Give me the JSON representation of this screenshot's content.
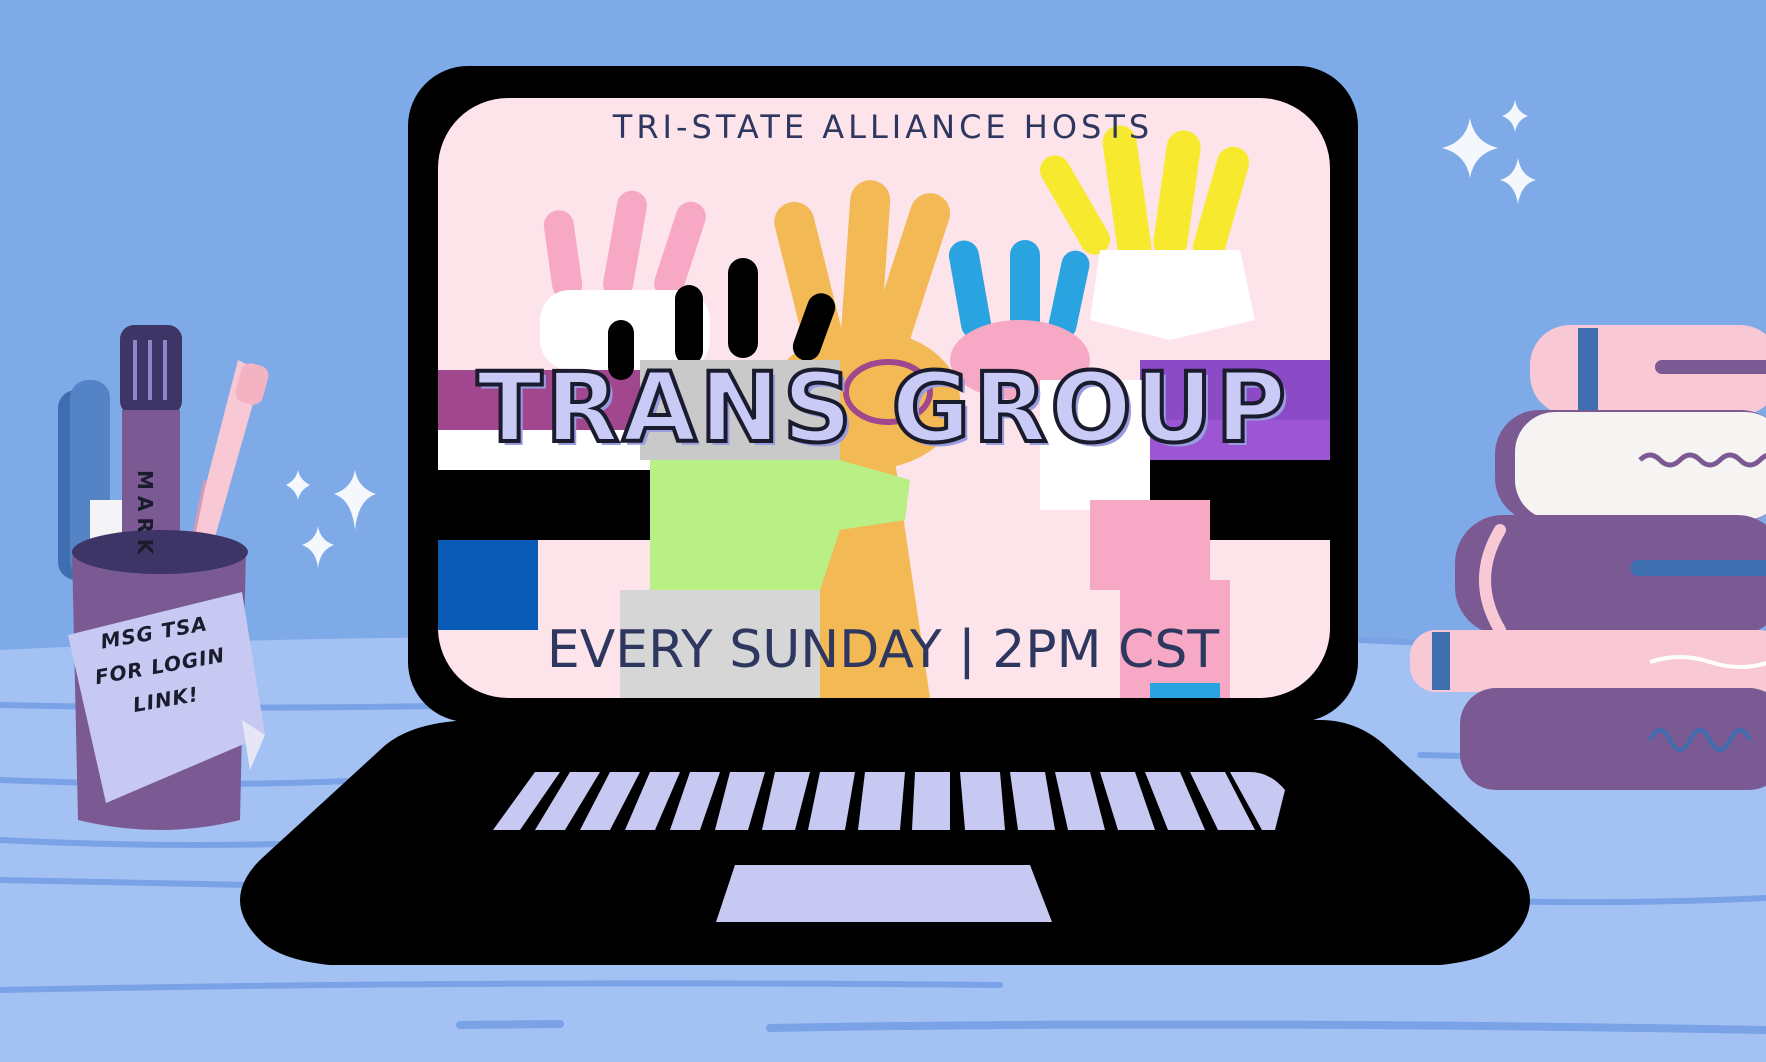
{
  "screen": {
    "headline": "TRI-STATE ALLIANCE HOSTS",
    "title": "TRANS GROUP",
    "schedule": "EVERY SUNDAY | 2PM CST"
  },
  "sticky_note": {
    "lines": [
      "MSG TSA",
      "FOR LOGIN",
      "LINK!"
    ]
  },
  "marker_label": "MARK",
  "colors": {
    "background": "#7eaae8",
    "desk": "#a4c1f4",
    "laptop": "#000000",
    "screen_bg": "#fde3ea",
    "keys": "#c7c9f3",
    "title_fill": "#c9caf5",
    "text": "#2e3760"
  },
  "icons": [
    "sparkle-icon",
    "pen-cup-icon",
    "book-stack-icon",
    "raised-hands-illustration"
  ]
}
